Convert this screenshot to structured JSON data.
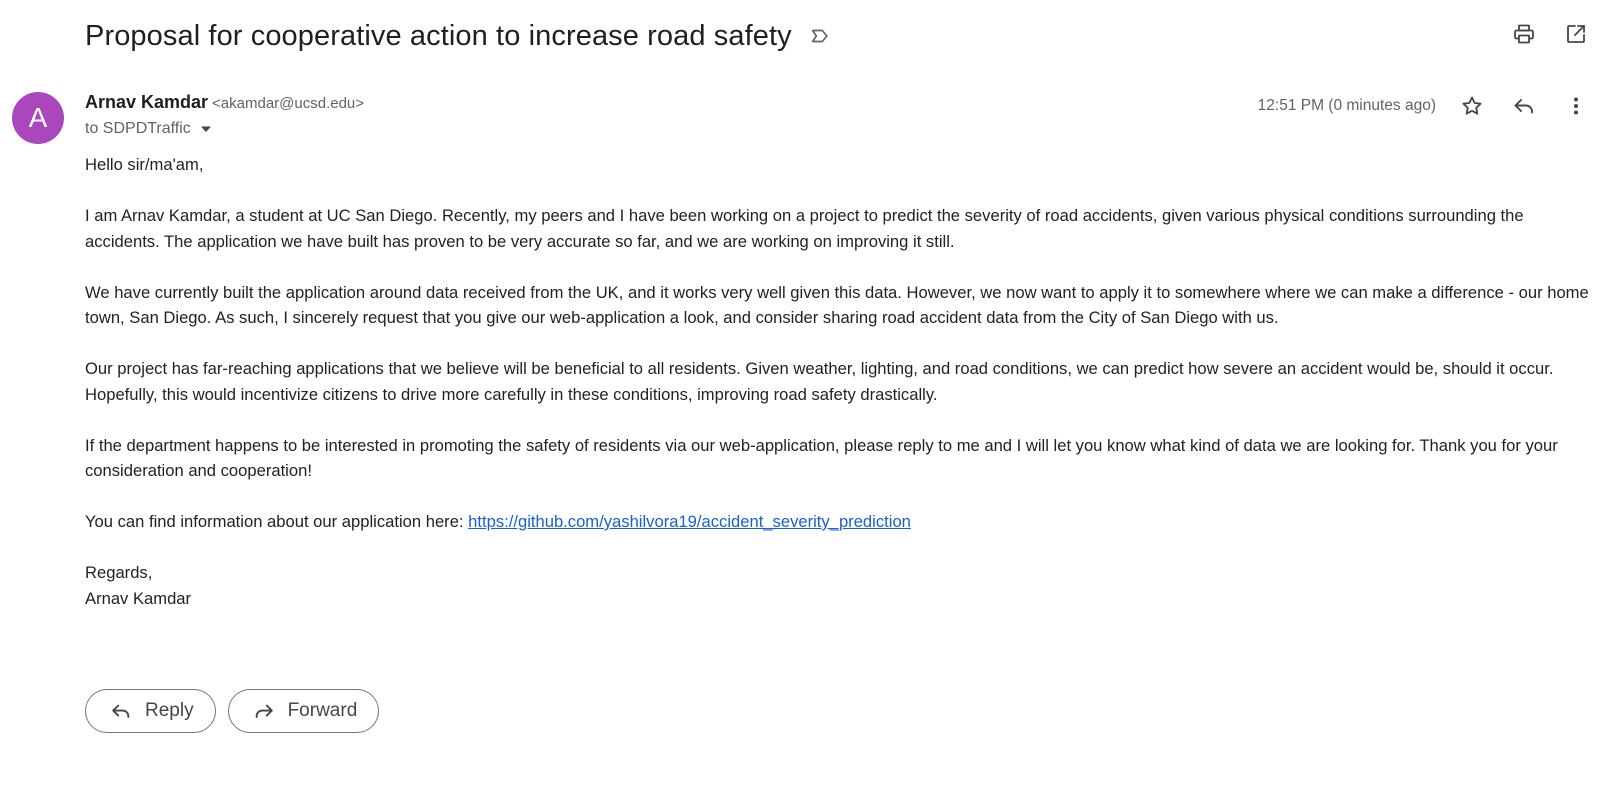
{
  "email": {
    "subject": "Proposal for cooperative action to increase road safety",
    "sender": {
      "initial": "A",
      "name": "Arnav Kamdar",
      "email": "<akamdar@ucsd.edu>",
      "avatar_color": "#ab47bc"
    },
    "recipient": "to SDPDTraffic",
    "timestamp": "12:51 PM (0 minutes ago)",
    "body": {
      "greeting": "Hello sir/ma'am,",
      "para1": "I am Arnav Kamdar, a student at UC San Diego. Recently, my peers and I have been working on a project to predict the severity of road accidents, given various physical conditions surrounding the accidents. The application we have built has proven to be very accurate so far, and we are working on improving it still.",
      "para2": "We have currently built the application around data received from the UK, and it works very well given this data. However, we now want to apply it to somewhere where we can make a difference - our home town, San Diego. As such, I sincerely request that you give our web-application a look, and consider sharing road accident data from the City of San Diego with us.",
      "para3": "Our project has far-reaching applications that we believe will be beneficial to all residents. Given weather, lighting, and road conditions, we can predict how severe an accident would be, should it occur. Hopefully, this would incentivize citizens to drive more carefully in these conditions, improving road safety drastically.",
      "para4": "If the department happens to be interested in promoting the safety of residents via our web-application, please reply to me and I will let you know what kind of data we are looking for. Thank you for your consideration and cooperation!",
      "link_prefix": "You can find information about our application here: ",
      "link_text": "https://github.com/yashilvora19/accident_severity_prediction",
      "closing": "Regards,",
      "signature": "Arnav Kamdar"
    }
  },
  "actions": {
    "reply_label": "Reply",
    "forward_label": "Forward"
  },
  "icons": {
    "label": "label-icon",
    "print": "print-icon",
    "open_new_window": "open-in-new-window-icon",
    "star": "star-icon",
    "reply": "reply-icon",
    "more": "more-vert-icon",
    "caret": "caret-down-icon",
    "forward": "forward-icon"
  },
  "colors": {
    "link": "#1a5fd0",
    "secondary_text": "#5f6368",
    "primary_text": "#222222"
  }
}
